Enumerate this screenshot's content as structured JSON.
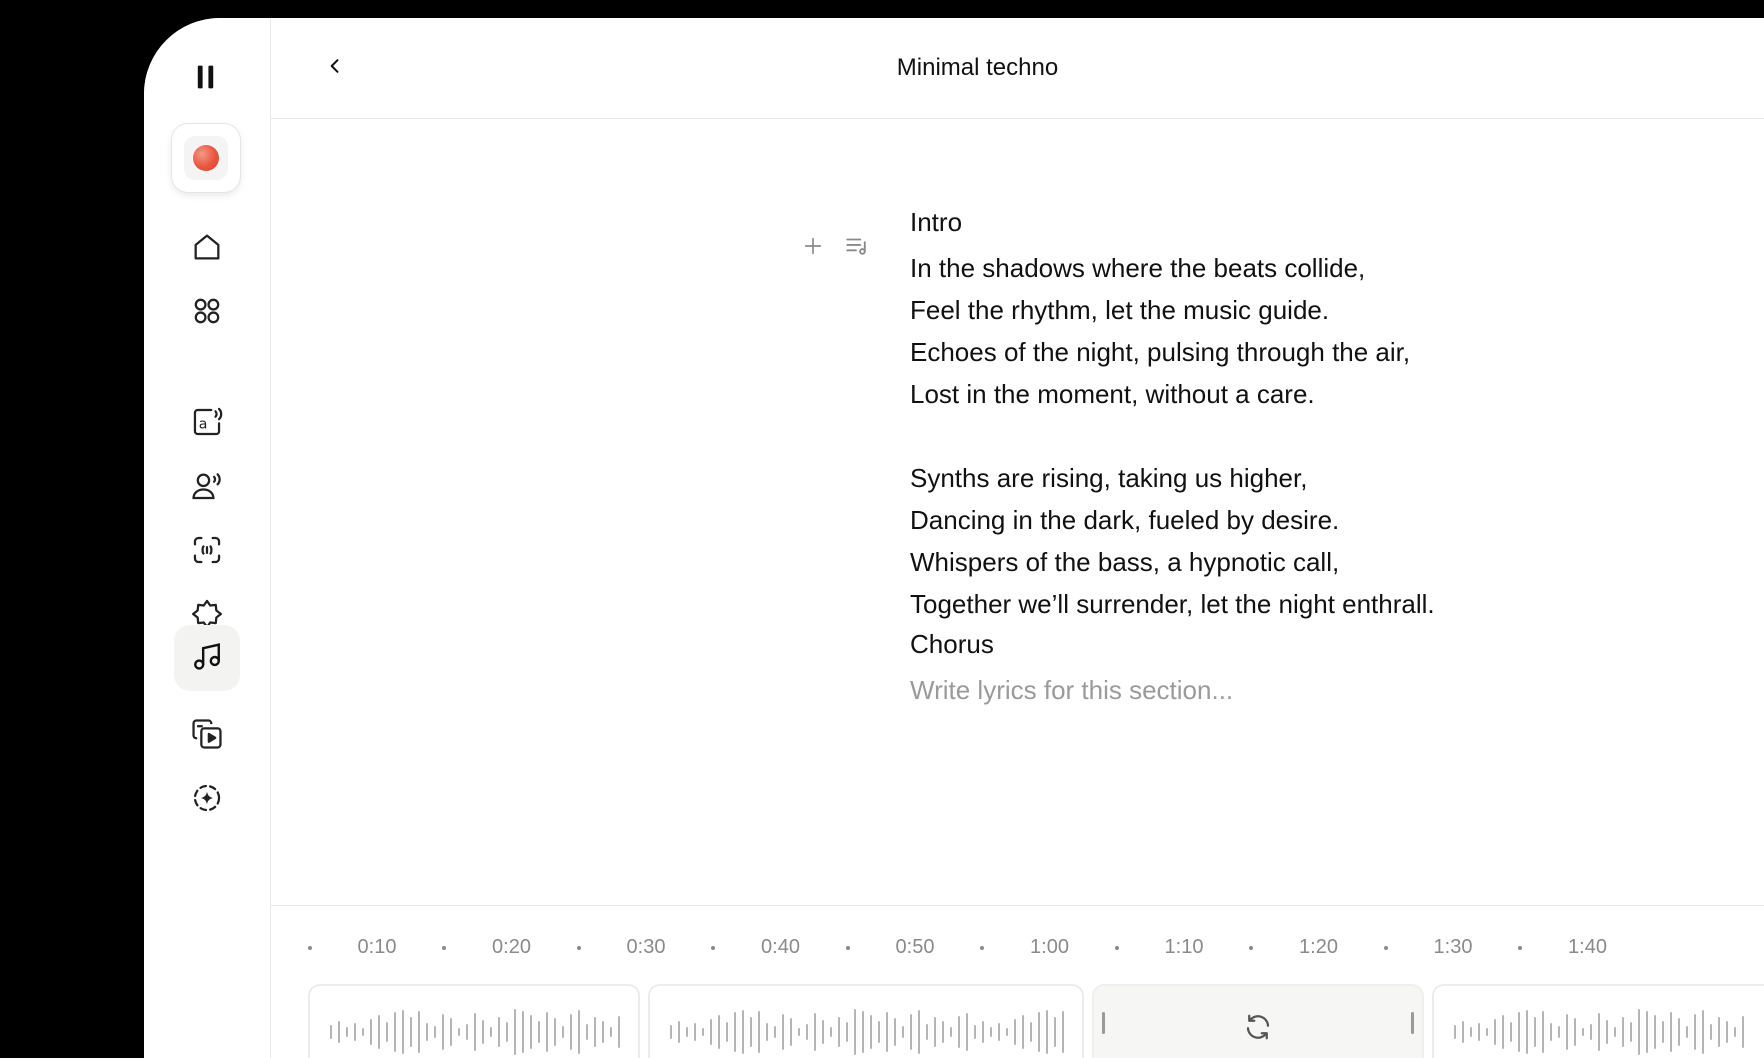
{
  "header": {
    "title": "Minimal techno"
  },
  "sidebar": {
    "items": [
      {
        "name": "pause",
        "icon": "pause-icon"
      },
      {
        "name": "record",
        "icon": "record-icon"
      },
      {
        "name": "home",
        "icon": "home-icon"
      },
      {
        "name": "apps",
        "icon": "grid-icon"
      },
      {
        "name": "text-to-speech",
        "icon": "text-speech-icon"
      },
      {
        "name": "voices",
        "icon": "voice-user-icon"
      },
      {
        "name": "speech-to-text",
        "icon": "scan-audio-icon"
      },
      {
        "name": "sound-effects",
        "icon": "badge-star-icon"
      },
      {
        "name": "music",
        "icon": "music-note-icon",
        "active": true
      },
      {
        "name": "video",
        "icon": "video-stack-icon"
      },
      {
        "name": "ai-tools",
        "icon": "sparkle-dial-icon"
      }
    ]
  },
  "editor": {
    "sections": [
      {
        "heading": "Intro",
        "lines": [
          "In the shadows where the beats collide,",
          "Feel the rhythm, let the music guide.",
          "Echoes of the night, pulsing through the air,",
          "Lost in the moment, without a care.",
          "",
          "Synths are rising, taking us higher,",
          "Dancing in the dark, fueled by desire.",
          "Whispers of the bass, a hypnotic call,",
          "Together we’ll surrender, let the night enthrall."
        ]
      },
      {
        "heading": "Chorus",
        "placeholder": "Write lyrics for this section..."
      }
    ]
  },
  "timeline": {
    "labels": [
      "0:10",
      "0:20",
      "0:30",
      "0:40",
      "0:50",
      "1:00",
      "1:10",
      "1:20",
      "1:30",
      "1:40"
    ],
    "clips": [
      {
        "state": "waveform"
      },
      {
        "state": "waveform"
      },
      {
        "state": "regenerate",
        "icon": "refresh-icon"
      },
      {
        "state": "waveform"
      }
    ]
  },
  "colors": {
    "record": "#e9543f",
    "border": "#e7e7e7",
    "placeholder": "#9a9a9a"
  }
}
